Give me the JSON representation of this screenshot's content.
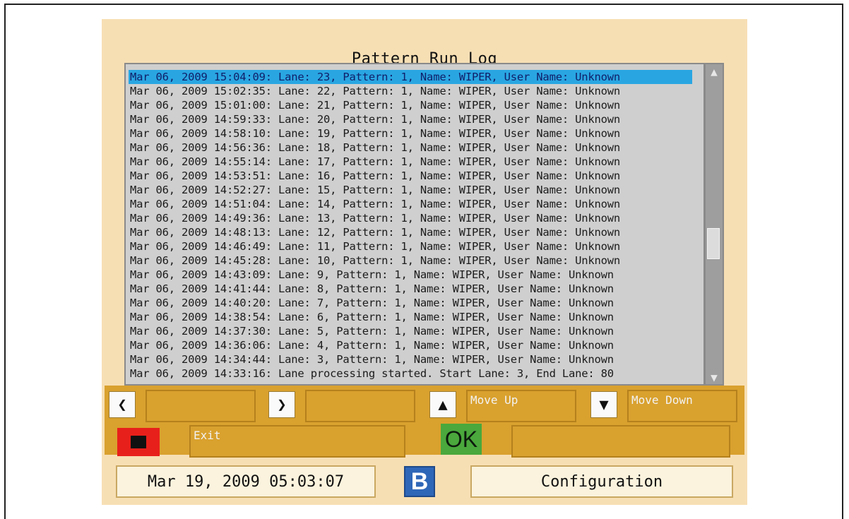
{
  "title": "Pattern Run Log",
  "log": {
    "entries": [
      "Mar 06, 2009 15:04:09: Lane: 23, Pattern: 1, Name: WIPER, User Name: Unknown",
      "Mar 06, 2009 15:02:35: Lane: 22, Pattern: 1, Name: WIPER, User Name: Unknown",
      "Mar 06, 2009 15:01:00: Lane: 21, Pattern: 1, Name: WIPER, User Name: Unknown",
      "Mar 06, 2009 14:59:33: Lane: 20, Pattern: 1, Name: WIPER, User Name: Unknown",
      "Mar 06, 2009 14:58:10: Lane: 19, Pattern: 1, Name: WIPER, User Name: Unknown",
      "Mar 06, 2009 14:56:36: Lane: 18, Pattern: 1, Name: WIPER, User Name: Unknown",
      "Mar 06, 2009 14:55:14: Lane: 17, Pattern: 1, Name: WIPER, User Name: Unknown",
      "Mar 06, 2009 14:53:51: Lane: 16, Pattern: 1, Name: WIPER, User Name: Unknown",
      "Mar 06, 2009 14:52:27: Lane: 15, Pattern: 1, Name: WIPER, User Name: Unknown",
      "Mar 06, 2009 14:51:04: Lane: 14, Pattern: 1, Name: WIPER, User Name: Unknown",
      "Mar 06, 2009 14:49:36: Lane: 13, Pattern: 1, Name: WIPER, User Name: Unknown",
      "Mar 06, 2009 14:48:13: Lane: 12, Pattern: 1, Name: WIPER, User Name: Unknown",
      "Mar 06, 2009 14:46:49: Lane: 11, Pattern: 1, Name: WIPER, User Name: Unknown",
      "Mar 06, 2009 14:45:28: Lane: 10, Pattern: 1, Name: WIPER, User Name: Unknown",
      "Mar 06, 2009 14:43:09: Lane: 9, Pattern: 1, Name: WIPER, User Name: Unknown",
      "Mar 06, 2009 14:41:44: Lane: 8, Pattern: 1, Name: WIPER, User Name: Unknown",
      "Mar 06, 2009 14:40:20: Lane: 7, Pattern: 1, Name: WIPER, User Name: Unknown",
      "Mar 06, 2009 14:38:54: Lane: 6, Pattern: 1, Name: WIPER, User Name: Unknown",
      "Mar 06, 2009 14:37:30: Lane: 5, Pattern: 1, Name: WIPER, User Name: Unknown",
      "Mar 06, 2009 14:36:06: Lane: 4, Pattern: 1, Name: WIPER, User Name: Unknown",
      "Mar 06, 2009 14:34:44: Lane: 3, Pattern: 1, Name: WIPER, User Name: Unknown",
      "Mar 06, 2009 14:33:16: Lane processing started. Start Lane: 3, End Lane: 80"
    ],
    "selected_index": 0
  },
  "scrollbar": {
    "up_icon": "triangle-up-icon",
    "down_icon": "triangle-down-icon"
  },
  "controls": {
    "left_icon": "arrow-left-icon",
    "right_icon": "arrow-right-icon",
    "up_icon": "arrow-up-icon",
    "down_icon": "arrow-down-icon",
    "move_up_label": "Move Up",
    "move_down_label": "Move Down",
    "stop_icon": "stop-icon",
    "exit_label": "Exit",
    "ok_label": "OK"
  },
  "footer": {
    "datetime": "Mar 19, 2009 05:03:07",
    "logo_text": "B",
    "configuration_label": "Configuration"
  },
  "colors": {
    "panel_bg": "#f7dfb4",
    "button_bar": "#d9a12e",
    "selection": "#29a6e2",
    "list_bg": "#cfcfcf",
    "stop_red": "#e8201b",
    "ok_green": "#4aa83c",
    "logo_blue": "#2f67b8"
  }
}
